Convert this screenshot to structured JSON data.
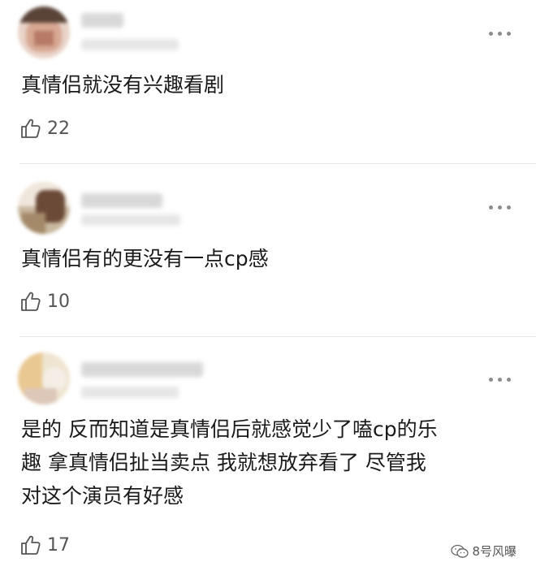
{
  "comments": [
    {
      "text": "真情侣就没有兴趣看剧",
      "likes": "22"
    },
    {
      "text": "真情侣有的更没有一点cp感",
      "likes": "10"
    },
    {
      "text": "是的 反而知道是真情侣后就感觉少了嗑cp的乐\n趣 拿真情侣扯当卖点 我就想放弃看了 尽管我\n对这个演员有好感",
      "likes": "17"
    }
  ],
  "icons": {
    "more": "more-icon",
    "like": "thumbs-up-icon",
    "watermark": "wechat-icon"
  },
  "watermark": {
    "label": "8号风曝"
  }
}
